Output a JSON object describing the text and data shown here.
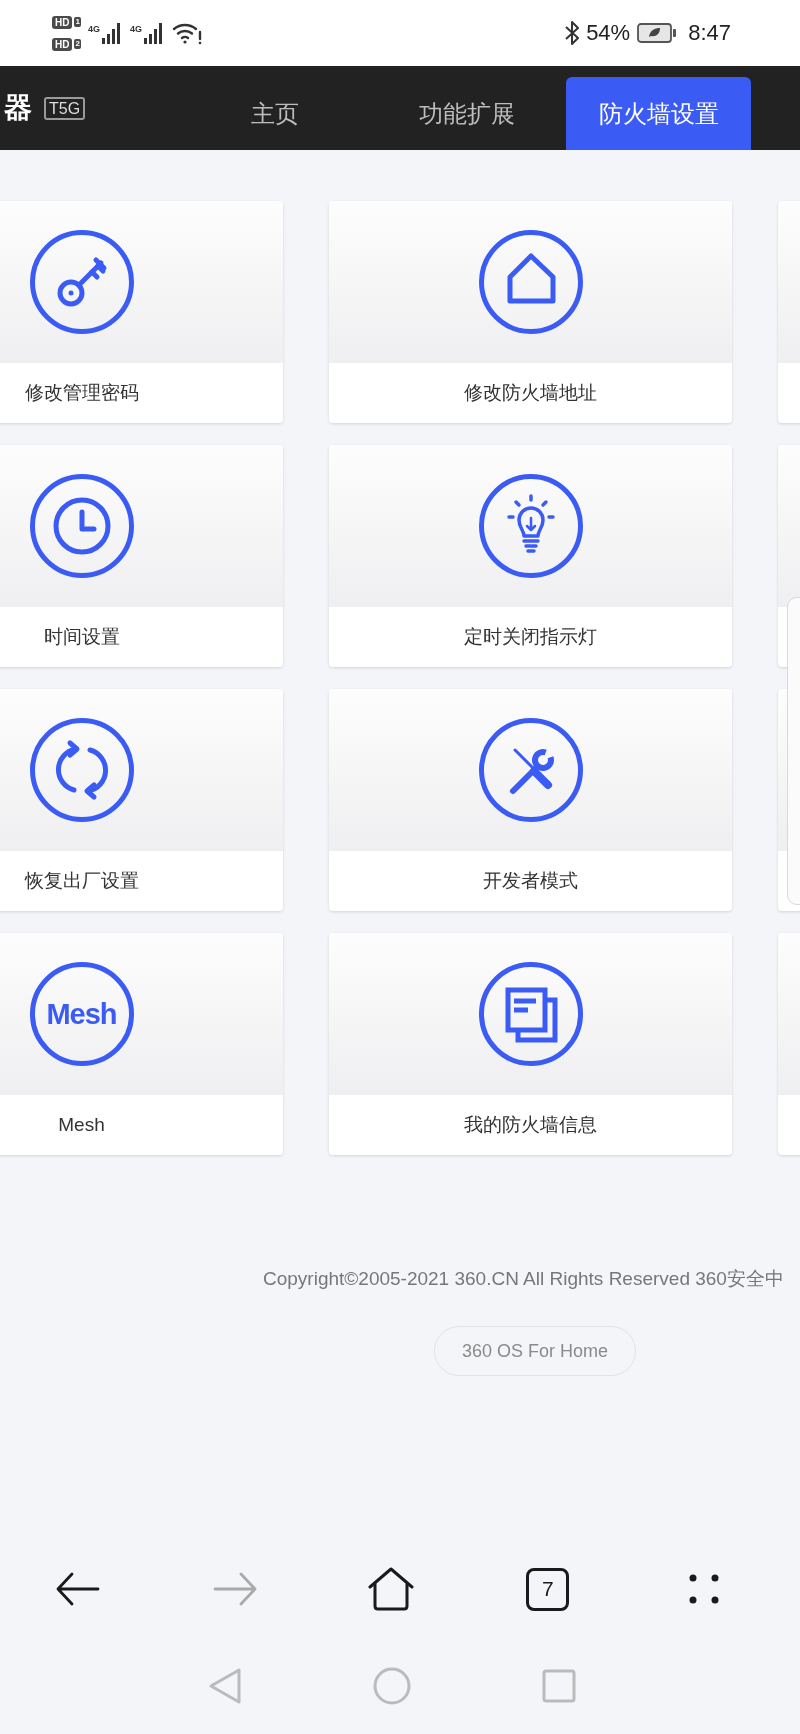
{
  "status_bar": {
    "sims": [
      {
        "label": "HD",
        "slot": "1"
      },
      {
        "label": "HD",
        "slot": "2"
      }
    ],
    "networks": [
      {
        "label": "4G"
      },
      {
        "label": "4G"
      }
    ],
    "battery": "54%",
    "time": "8:47"
  },
  "header": {
    "logo": "器",
    "model": "T5G",
    "tabs": [
      {
        "label": "主页",
        "selected": false
      },
      {
        "label": "功能扩展",
        "selected": false
      },
      {
        "label": "防火墙设置",
        "selected": true
      }
    ]
  },
  "tiles": [
    {
      "kind": "key",
      "label": "修改管理密码"
    },
    {
      "kind": "house",
      "label": "修改防火墙地址"
    },
    {
      "kind": "clock",
      "label": "时间设置"
    },
    {
      "kind": "bulb",
      "label": "定时关闭指示灯"
    },
    {
      "kind": "sync",
      "label": "恢复出厂设置"
    },
    {
      "kind": "tools",
      "label": "开发者模式"
    },
    {
      "kind": "mesh",
      "icon_text": "Mesh",
      "label": "Mesh"
    },
    {
      "kind": "documents",
      "label": "我的防火墙信息"
    }
  ],
  "footer": {
    "copyright": "Copyright©2005-2021 360.CN All Rights Reserved 360安全中",
    "badge": "360 OS For Home"
  },
  "browser_bar": {
    "buttons": [
      {
        "kind": "back",
        "disabled": false
      },
      {
        "kind": "forward",
        "disabled": true
      },
      {
        "kind": "home",
        "disabled": false
      },
      {
        "kind": "tabs",
        "label": "7",
        "disabled": false
      },
      {
        "kind": "menu",
        "disabled": false
      }
    ]
  }
}
